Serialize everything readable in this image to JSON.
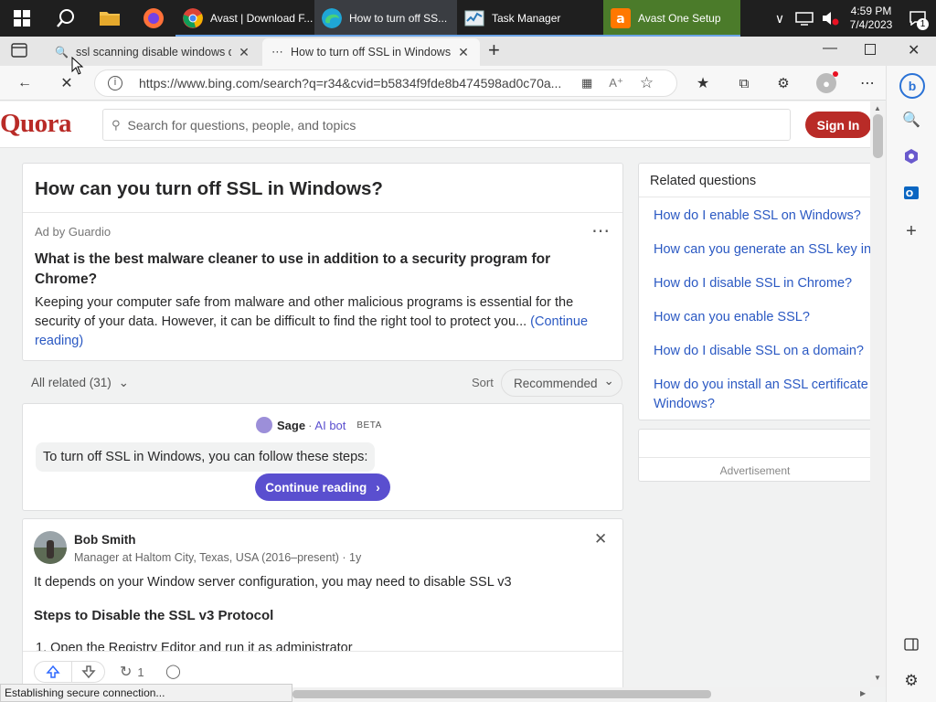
{
  "taskbar": {
    "apps": [
      {
        "label": "Avast | Download F...",
        "icon": "chrome-icon"
      },
      {
        "label": "How to turn off SS...",
        "icon": "edge-icon"
      },
      {
        "label": "Task Manager",
        "icon": "task-manager-icon"
      },
      {
        "label": "Avast One Setup",
        "icon": "avast-icon"
      }
    ],
    "time": "4:59 PM",
    "date": "7/4/2023",
    "notification_count": "1"
  },
  "browser": {
    "tabs": [
      {
        "title": "ssl scanning disable windows det"
      },
      {
        "title": "How to turn off SSL in Windows"
      }
    ],
    "url": "https://www.bing.com/search?q=r34&cvid=b5834f9fde8b474598ad0c70a...",
    "status": "Establishing secure connection..."
  },
  "quora": {
    "logo": "Quora",
    "search_placeholder": "Search for questions, people, and topics",
    "signin": "Sign In",
    "question": "How can you turn off SSL in Windows?",
    "ad": {
      "by": "Ad by Guardio",
      "title": "What is the best malware cleaner to use in addition to a security program for Chrome?",
      "body": "Keeping your computer safe from malware and other malicious programs is essential for the security of your data. However, it can be difficult to find the right tool to protect you...",
      "continue": "(Continue reading)"
    },
    "related_filter": "All related (31)",
    "sort_label": "Sort",
    "sort_value": "Recommended",
    "sage": {
      "name": "Sage",
      "sep": "·",
      "ai": "AI bot",
      "beta": "BETA",
      "message": "To turn off SSL in Windows, you can follow these steps:",
      "continue": "Continue reading"
    },
    "answer": {
      "author": "Bob Smith",
      "credential": "Manager at Haltom City, Texas, USA (2016–present) · 1y",
      "text": "It depends on your Window server configuration, you may need to disable SSL v3",
      "heading": "Steps to Disable the SSL v3 Protocol",
      "step1": "1. Open the Registry Editor and run it as administrator",
      "shares": "1"
    },
    "related": {
      "title": "Related questions",
      "items": [
        "How do I enable SSL on Windows?",
        "How can you generate an SSL key in",
        "How do I disable SSL in Chrome?",
        "How can you enable SSL?",
        "How do I disable SSL on a domain?",
        "How do you install an SSL certificate",
        "Windows?"
      ]
    },
    "advertisement": "Advertisement"
  }
}
